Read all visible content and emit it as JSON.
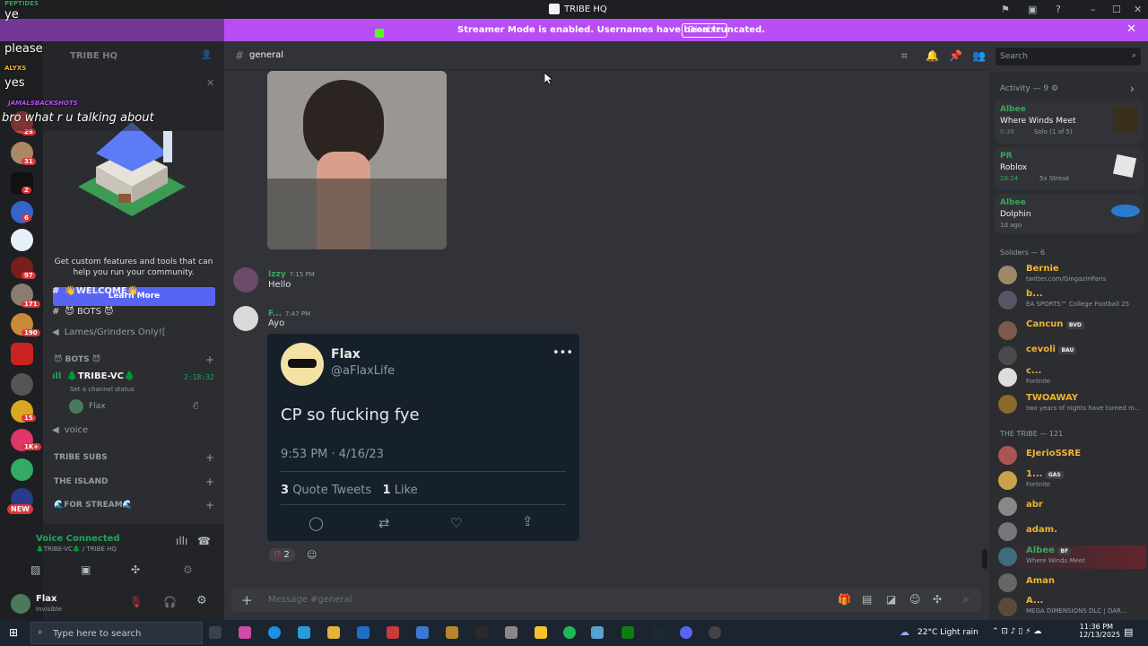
{
  "window": {
    "title": "TRIBE HQ"
  },
  "banner": {
    "message": "Streamer Mode is enabled. Usernames have been truncated.",
    "disable_label": "Disable"
  },
  "overlay_chat": [
    {
      "user": "PEPTIDES",
      "text": "ye"
    },
    {
      "user": "",
      "text": "please"
    },
    {
      "user": "ALYXS",
      "text": "yes"
    },
    {
      "user": "JAMALSBACKSHOTS",
      "text": "bro what r u talking about"
    }
  ],
  "server": {
    "name": "TRIBE HQ"
  },
  "guild_badges": [
    "29",
    "31",
    "2",
    "6",
    "97",
    "171",
    "190",
    "15",
    "1K+",
    "NEW"
  ],
  "promo": {
    "text": "Get custom features and tools that can help you run your community.",
    "button": "Learn More"
  },
  "channels": {
    "welcome": "👋WELCOME👋",
    "bots": "😈 BOTS 😈",
    "lames": "Lames/Grinders Only![",
    "cat_bots": "😈 BOTS 😈",
    "tribe_vc": "🌲TRIBE-VC🌲",
    "tribe_vc_time": "2:18:32",
    "set_status": "Set a channel status",
    "vc_user": "Flax",
    "voice": "voice",
    "cat_subs": "TRIBE SUBS",
    "cat_island": "THE ISLAND",
    "cat_stream": "🌊FOR STREAM🌊"
  },
  "voice_panel": {
    "status": "Voice Connected",
    "channel": "🌲TRIBE-VC🌲 / TRIBE HQ"
  },
  "user_panel": {
    "name": "Flax",
    "status": "Invisible"
  },
  "chat": {
    "channel": "general",
    "messages": [
      {
        "author": "Izzy",
        "time": "7:15 PM",
        "text": "Hello"
      },
      {
        "author": "F...",
        "time": "7:47 PM",
        "text": "Ayo"
      }
    ],
    "reaction_count": "2",
    "input_placeholder": "Message #general"
  },
  "tweet": {
    "name": "Flax",
    "handle": "@aFlaxLife",
    "text": "CP so fucking fye",
    "datetime": "9:53 PM · 4/16/23",
    "quote_count": "3",
    "quote_label": "Quote Tweets",
    "like_count": "1",
    "like_label": "Like"
  },
  "search": {
    "placeholder": "Search"
  },
  "activity": {
    "header": "Activity — 9",
    "items": [
      {
        "user": "Albee",
        "game": "Where Winds Meet",
        "time": "0:39",
        "extra": "Solo (1 of 5)"
      },
      {
        "user": "PR",
        "game": "Roblox",
        "time": "28:24",
        "extra": "5x Streak"
      },
      {
        "user": "Albee",
        "game": "Dolphin",
        "time": "",
        "extra": "1d ago"
      }
    ]
  },
  "members": {
    "soldiers_header": "Soliders — 6",
    "soldiers": [
      {
        "name": "Bernie",
        "sub": "twitter.com/GingazInParis",
        "color": "#f0b232"
      },
      {
        "name": "b...",
        "sub": "EA SPORTS™ College Football 25",
        "color": "#dbdee1"
      },
      {
        "name": "Cancun",
        "tag": "BVD",
        "sub": "",
        "color": "#f0b232"
      },
      {
        "name": "cevoli",
        "tag": "BAU",
        "sub": "",
        "color": "#f0b232"
      },
      {
        "name": "c...",
        "sub": "Fortnite",
        "color": "#f0b232"
      },
      {
        "name": "TWOAWAY",
        "sub": "two years of nights have turned m...",
        "color": "#f0b232"
      }
    ],
    "tribe_header": "THE TRIBE — 121",
    "tribe": [
      {
        "name": "EJerioSSRE",
        "sub": "",
        "color": "#f0b232"
      },
      {
        "name": "1...",
        "tag": "GAS",
        "sub": "Fortnite",
        "color": "#f0b232"
      },
      {
        "name": "abr",
        "sub": "",
        "color": "#f0b232"
      },
      {
        "name": "adam.",
        "sub": "",
        "color": "#f0b232"
      },
      {
        "name": "Albee",
        "tag": "BF",
        "sub": "Where Winds Meet",
        "color": "#3ba55d"
      },
      {
        "name": "Aman",
        "sub": "",
        "color": "#f0b232"
      },
      {
        "name": "A...",
        "sub": "MEGA DIMENSIONS DLC | DAR...",
        "color": "#f0b232"
      }
    ]
  },
  "taskbar": {
    "search_placeholder": "Type here to search",
    "weather": "22°C  Light rain",
    "time": "11:36 PM",
    "date": "12/13/2025"
  },
  "colors": {
    "accent": "#5865f2",
    "banner": "#b84df5",
    "online": "#23a55a",
    "gold": "#f0b232"
  }
}
